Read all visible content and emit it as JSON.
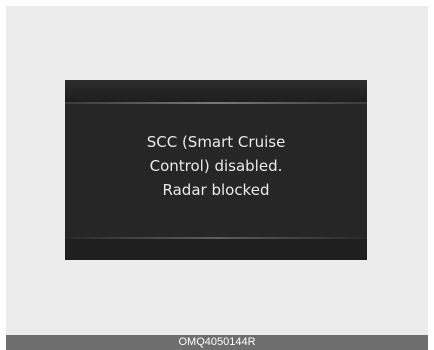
{
  "display": {
    "message_lines": [
      "SCC (Smart Cruise",
      "Control) disabled.",
      "Radar blocked"
    ]
  },
  "footer": {
    "image_code": "OMQ4050144R"
  },
  "colors": {
    "background": "#ececec",
    "display_background": "#262626",
    "text": "#e9e9e9",
    "footer_background": "#6e6e6e"
  }
}
